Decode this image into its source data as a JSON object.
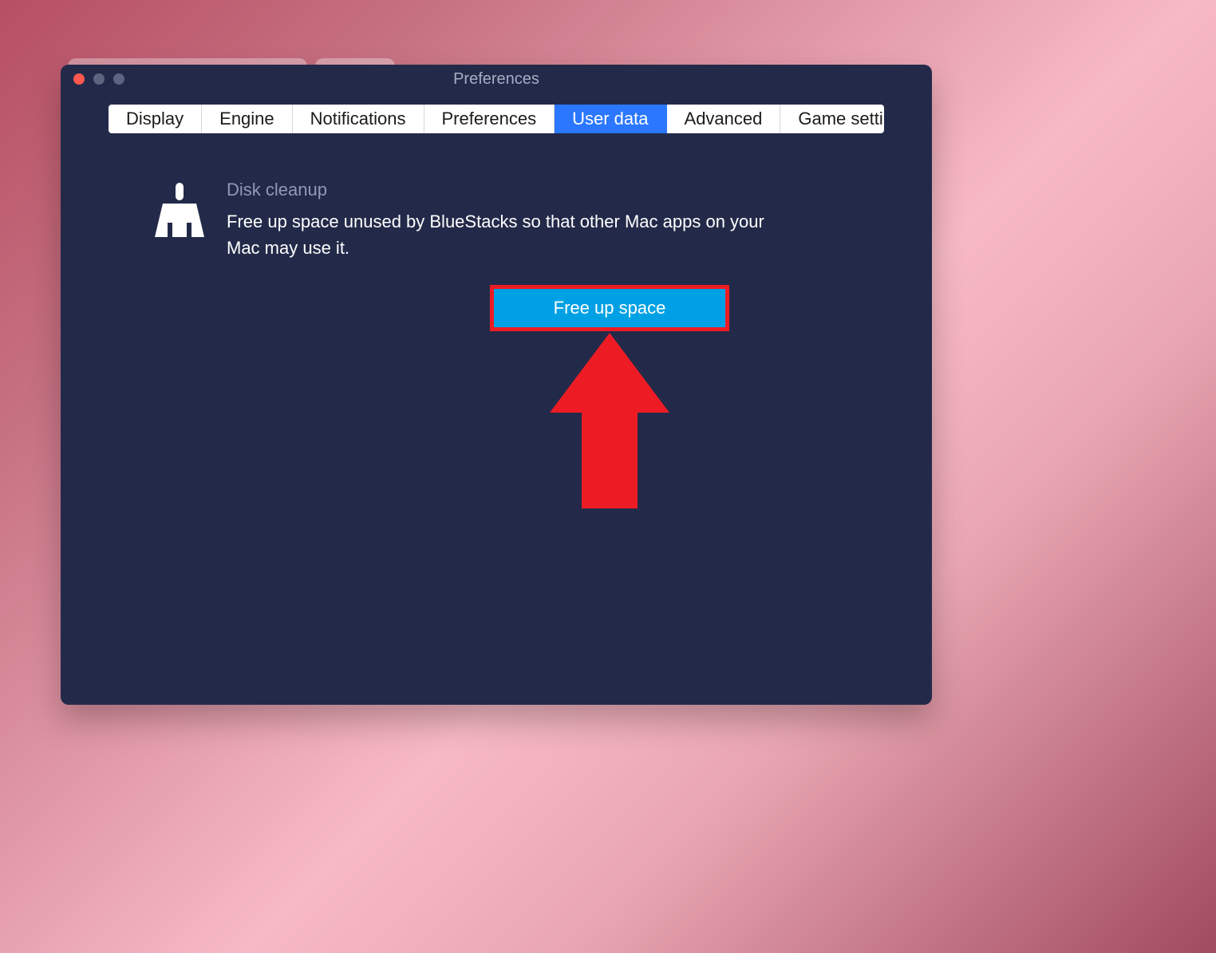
{
  "window": {
    "title": "Preferences"
  },
  "tabs": [
    {
      "label": "Display"
    },
    {
      "label": "Engine"
    },
    {
      "label": "Notifications"
    },
    {
      "label": "Preferences"
    },
    {
      "label": "User data",
      "active": true
    },
    {
      "label": "Advanced"
    },
    {
      "label": "Game settings"
    }
  ],
  "disk_cleanup": {
    "title": "Disk cleanup",
    "description": "Free up space unused by BlueStacks so that other Mac apps on your Mac may use it.",
    "button_label": "Free up space"
  },
  "annotation": {
    "arrow_color": "#ed1c24",
    "highlight_color": "#ed1c24"
  }
}
